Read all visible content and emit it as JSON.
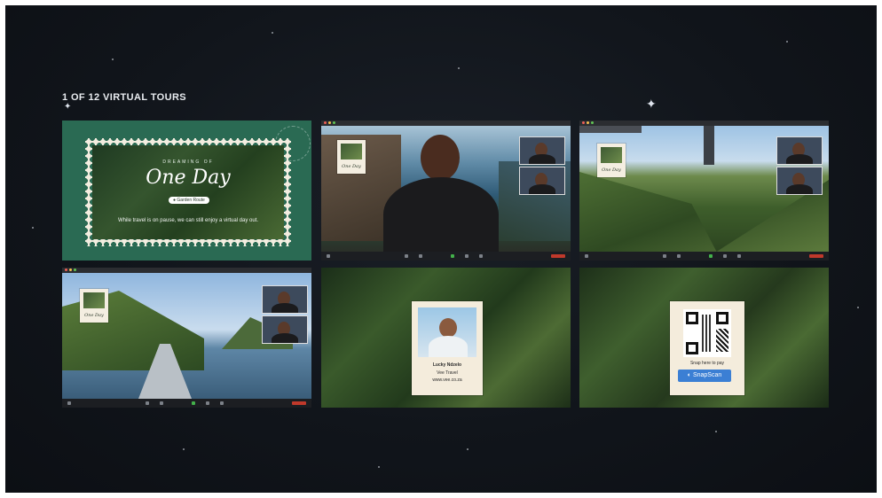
{
  "heading": "1 OF 12 VIRTUAL TOURS",
  "panels": {
    "slide": {
      "kicker": "DREAMING OF",
      "title": "One Day",
      "location": "Garden Route",
      "tagline": "While travel is on pause, we can still enjoy a virtual day out."
    },
    "guide_card": {
      "name": "Lucky Ndzelo",
      "role": "Vee Travel",
      "site": "www.vee.co.za"
    },
    "payment": {
      "caption": "Snap here to pay",
      "button": "SnapScan"
    },
    "mini_stamp_text": "One Day"
  },
  "colors": {
    "background": "#11151b",
    "slide_green": "#2a6a53",
    "stamp_cream": "#f4ecdc",
    "snapscan_blue": "#3b7fd4",
    "end_red": "#c0392b"
  }
}
